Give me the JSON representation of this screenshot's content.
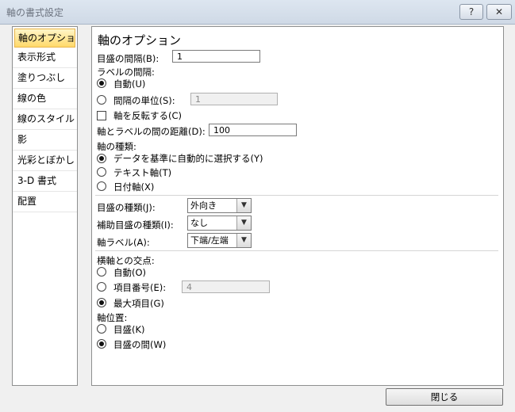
{
  "window": {
    "title": "軸の書式設定",
    "help_button": "?",
    "close_button": "✕"
  },
  "sidebar": {
    "items": [
      {
        "label": "軸のオプション",
        "selected": true
      },
      {
        "label": "表示形式"
      },
      {
        "label": "塗りつぶし"
      },
      {
        "label": "線の色"
      },
      {
        "label": "線のスタイル"
      },
      {
        "label": "影"
      },
      {
        "label": "光彩とぼかし"
      },
      {
        "label": "3-D 書式"
      },
      {
        "label": "配置"
      }
    ]
  },
  "panel": {
    "heading": "軸のオプション",
    "tick_interval": {
      "label": "目盛の間隔(B):",
      "value": "1"
    },
    "label_interval": {
      "label": "ラベルの間隔:",
      "auto": "自動(U)",
      "unit": "間隔の単位(S):",
      "unit_value": "1",
      "selected": "auto"
    },
    "reverse": {
      "label": "軸を反転する(C)",
      "checked": false
    },
    "label_distance": {
      "label": "軸とラベルの間の距離(D):",
      "value": "100"
    },
    "axis_type": {
      "label": "軸の種類:",
      "options": [
        "データを基準に自動的に選択する(Y)",
        "テキスト軸(T)",
        "日付軸(X)"
      ],
      "selected": 0
    },
    "major_tick": {
      "label": "目盛の種類(J):",
      "value": "外向き"
    },
    "minor_tick": {
      "label": "補助目盛の種類(I):",
      "value": "なし"
    },
    "axis_labels": {
      "label": "軸ラベル(A):",
      "value": "下端/左端"
    },
    "crosses": {
      "label": "横軸との交点:",
      "auto": "自動(O)",
      "number": "項目番号(E):",
      "number_value": "4",
      "max": "最大項目(G)",
      "selected": "max"
    },
    "axis_position": {
      "label": "軸位置:",
      "on_ticks": "目盛(K)",
      "between": "目盛の間(W)",
      "selected": "between"
    }
  },
  "footer": {
    "close_label": "閉じる"
  }
}
